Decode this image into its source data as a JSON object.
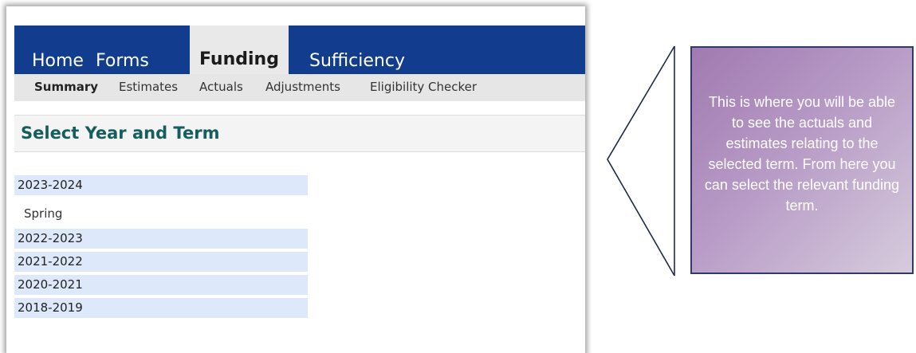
{
  "nav": {
    "tabs": [
      {
        "label": "Home"
      },
      {
        "label": "Forms"
      },
      {
        "label": "Funding",
        "active": true
      },
      {
        "label": "Sufficiency"
      }
    ]
  },
  "subnav": {
    "items": [
      {
        "label": "Summary",
        "active": true
      },
      {
        "label": "Estimates"
      },
      {
        "label": "Actuals"
      },
      {
        "label": "Adjustments"
      },
      {
        "label": "Eligibility Checker"
      }
    ]
  },
  "section": {
    "title": "Select Year and Term"
  },
  "years": [
    {
      "label": "2023-2024",
      "terms": [
        "Spring"
      ]
    },
    {
      "label": "2022-2023"
    },
    {
      "label": "2021-2022"
    },
    {
      "label": "2020-2021"
    },
    {
      "label": "2018-2019"
    }
  ],
  "callout": {
    "text": "This is where you will be able to see the actuals and estimates relating to the selected term. From here you can select the relevant funding term."
  },
  "colors": {
    "nav_blue": "#123d8f",
    "title_teal": "#165e5e",
    "row_blue": "#dde8fb",
    "callout_purple": "#a07ab0"
  }
}
